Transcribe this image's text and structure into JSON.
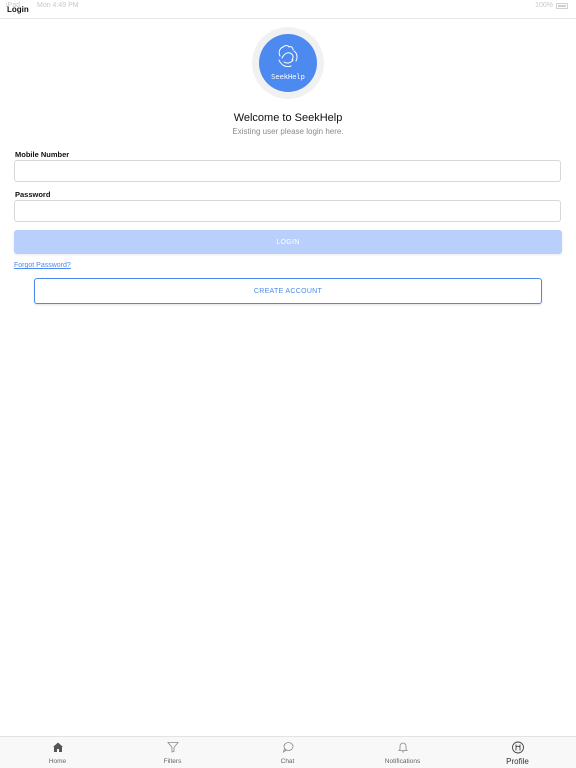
{
  "status_bar": {
    "left": "iPad",
    "center": "Mon 4:49 PM",
    "battery": "100%"
  },
  "nav": {
    "title": "Login"
  },
  "brand": {
    "logo_text": "SeekHelp",
    "welcome": "Welcome to SeekHelp",
    "subtitle": "Existing user please login here."
  },
  "form": {
    "mobile_label": "Mobile Number",
    "mobile_value": "",
    "password_label": "Password",
    "password_value": "",
    "login_label": "LOGIN",
    "forgot_label": "Forgot Password?",
    "create_label": "CREATE ACCOUNT"
  },
  "tabs": [
    {
      "label": "Home",
      "icon": "home-icon"
    },
    {
      "label": "Filters",
      "icon": "filter-icon"
    },
    {
      "label": "Chat",
      "icon": "chat-icon"
    },
    {
      "label": "Notifications",
      "icon": "bell-icon"
    },
    {
      "label": "Profile",
      "icon": "profile-icon",
      "active": true
    }
  ],
  "colors": {
    "accent": "#4d8af0",
    "login_disabled": "#b8d0fb"
  }
}
